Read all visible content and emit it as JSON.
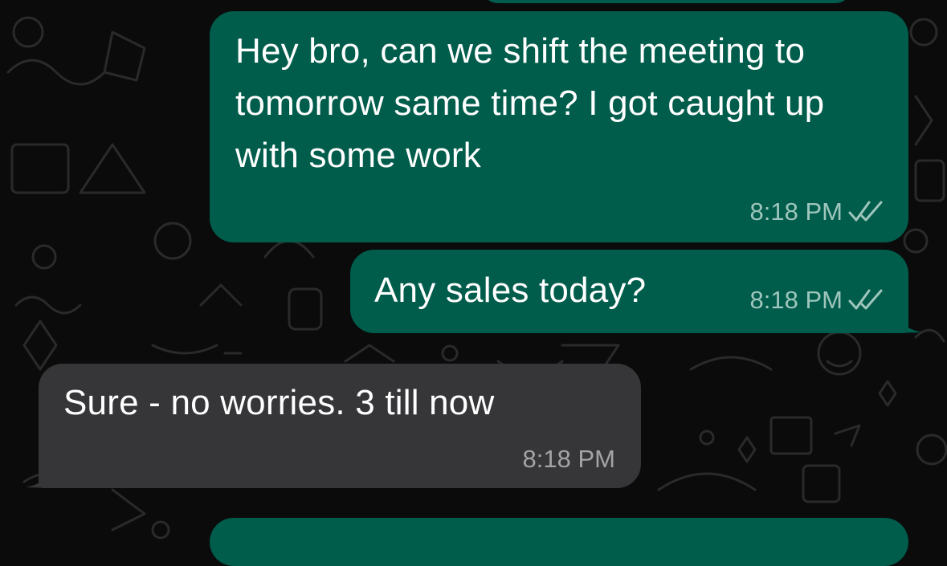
{
  "chat": {
    "messages": [
      {
        "direction": "outgoing",
        "text": "Hey bro, can we shift the meeting to tomorrow same time? I got caught up with some work",
        "time": "8:18 PM",
        "status_icon": "double-check-icon"
      },
      {
        "direction": "outgoing",
        "text": "Any sales today?",
        "time": "8:18 PM",
        "status_icon": "double-check-icon"
      },
      {
        "direction": "incoming",
        "text": "Sure - no worries. 3 till now",
        "time": "8:18 PM"
      }
    ]
  },
  "colors": {
    "background": "#0b0b0b",
    "outgoing_bubble": "#005c4b",
    "incoming_bubble": "#363638",
    "text": "#ffffff",
    "outgoing_meta": "#9fc6bc",
    "incoming_meta": "#a3a3a8"
  }
}
